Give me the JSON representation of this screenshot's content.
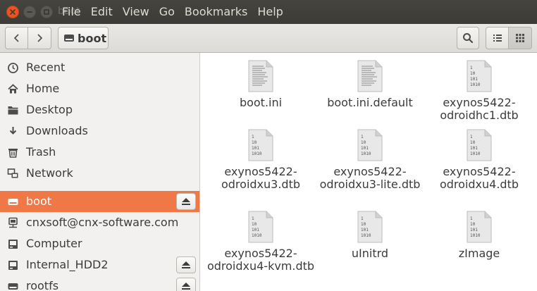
{
  "window": {
    "title": "boot",
    "menu": [
      "File",
      "Edit",
      "View",
      "Go",
      "Bookmarks",
      "Help"
    ]
  },
  "toolbar": {
    "path_label": "boot"
  },
  "sidebar": {
    "items": [
      {
        "label": "Recent",
        "icon": "clock-icon"
      },
      {
        "label": "Home",
        "icon": "home-icon"
      },
      {
        "label": "Desktop",
        "icon": "folder-icon"
      },
      {
        "label": "Downloads",
        "icon": "download-icon"
      },
      {
        "label": "Trash",
        "icon": "trash-icon"
      },
      {
        "label": "Network",
        "icon": "network-icon"
      },
      {
        "label": "boot",
        "icon": "drive-icon",
        "selected": true,
        "eject": true
      },
      {
        "label": "cnxsoft@cnx-software.com",
        "icon": "remote-drive-icon"
      },
      {
        "label": "Computer",
        "icon": "computer-icon"
      },
      {
        "label": "Internal_HDD2",
        "icon": "drive-icon",
        "eject": true
      },
      {
        "label": "rootfs",
        "icon": "drive-icon",
        "eject": true
      }
    ]
  },
  "files": [
    {
      "name": "boot.ini",
      "type": "text"
    },
    {
      "name": "boot.ini.default",
      "type": "text"
    },
    {
      "name": "exynos5422-odroidhc1.dtb",
      "type": "binary"
    },
    {
      "name": "exynos5422-odroidxu3.dtb",
      "type": "binary"
    },
    {
      "name": "exynos5422-odroidxu3-lite.dtb",
      "type": "binary"
    },
    {
      "name": "exynos5422-odroidxu4.dtb",
      "type": "binary"
    },
    {
      "name": "exynos5422-odroidxu4-kvm.dtb",
      "type": "binary"
    },
    {
      "name": "uInitrd",
      "type": "binary"
    },
    {
      "name": "zImage",
      "type": "binary"
    }
  ],
  "binary_icon_text": "1\n10\n101\n1010",
  "colors": {
    "accent": "#f07746",
    "titlebar": "#3c3b37",
    "close_button": "#e95420"
  }
}
